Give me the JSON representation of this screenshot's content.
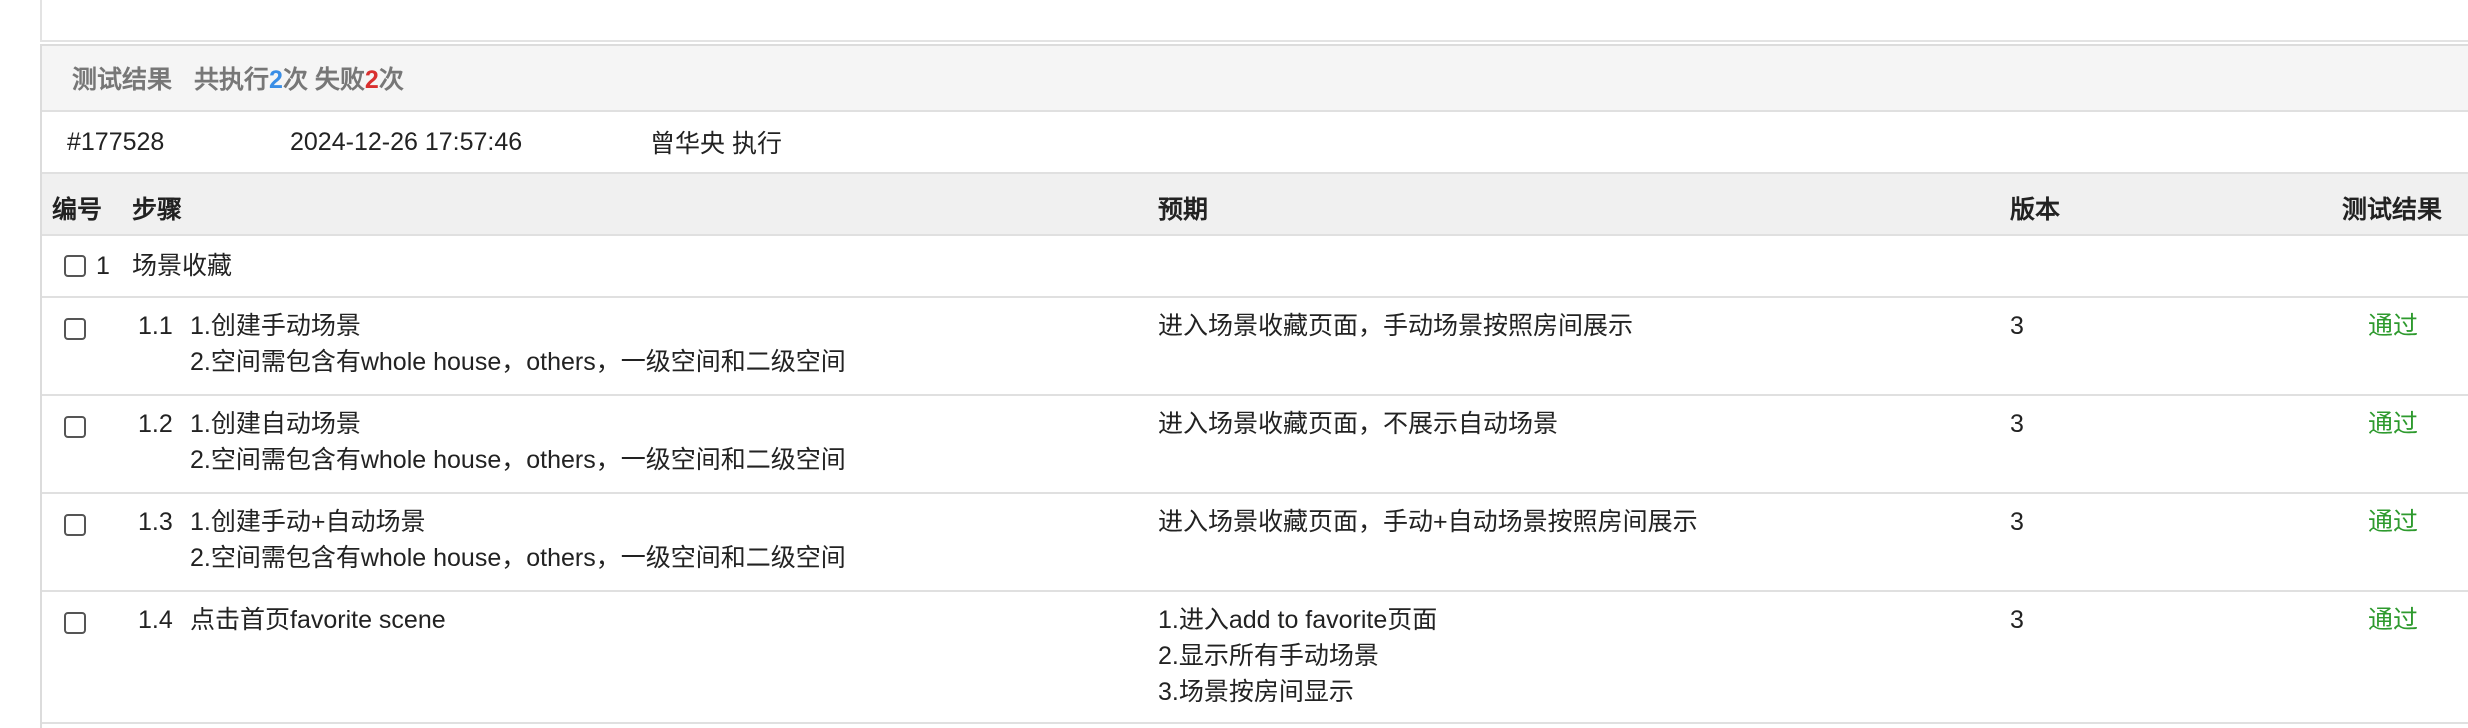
{
  "results_header": {
    "title": "测试结果",
    "summary_prefix": "共执行",
    "executed_count": "2",
    "executed_unit": "次",
    "failed_prefix": " 失败",
    "failed_count": "2",
    "failed_unit": "次"
  },
  "run": {
    "id": "#177528",
    "time": "2024-12-26 17:57:46",
    "executor": "曾华央 执行"
  },
  "columns": {
    "number": "编号",
    "steps": "步骤",
    "expected": "预期",
    "version": "版本",
    "result": "测试结果"
  },
  "group": {
    "number": "1",
    "name": "场景收藏"
  },
  "steps": [
    {
      "number": "1.1",
      "step": "1.创建手动场景\n2.空间需包含有whole house，others，一级空间和二级空间",
      "expected": "进入场景收藏页面，手动场景按照房间展示",
      "version": "3",
      "result": "通过"
    },
    {
      "number": "1.2",
      "step": "1.创建自动场景\n2.空间需包含有whole house，others，一级空间和二级空间",
      "expected": "进入场景收藏页面，不展示自动场景",
      "version": "3",
      "result": "通过"
    },
    {
      "number": "1.3",
      "step": "1.创建手动+自动场景\n2.空间需包含有whole house，others，一级空间和二级空间",
      "expected": "进入场景收藏页面，手动+自动场景按照房间展示",
      "version": "3",
      "result": "通过"
    },
    {
      "number": "1.4",
      "step": "点击首页favorite scene",
      "expected": "1.进入add to favorite页面\n2.显示所有手动场景\n3.场景按房间显示",
      "version": "3",
      "result": "通过"
    }
  ]
}
